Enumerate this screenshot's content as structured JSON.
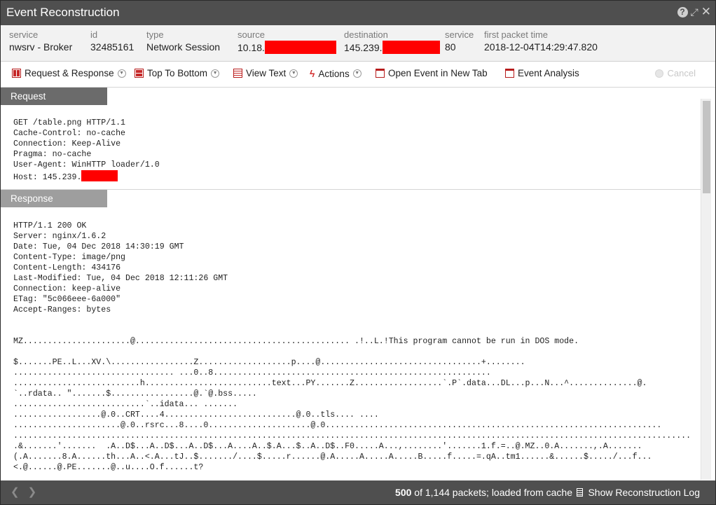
{
  "window": {
    "title": "Event Reconstruction",
    "help_icon": "help-icon",
    "expand_icon": "expand-icon",
    "close_icon": "close-icon"
  },
  "meta": {
    "service_label": "service",
    "service_value": "nwsrv - Broker",
    "id_label": "id",
    "id_value": "32485161",
    "type_label": "type",
    "type_value": "Network Session",
    "source_label": "source",
    "source_value": "10.18.",
    "destination_label": "destination",
    "destination_value": "145.239.",
    "service2_label": "service",
    "service2_value": "80",
    "first_packet_label": "first packet time",
    "first_packet_value": "2018-12-04T14:29:47.820",
    "redaction_color": "#ff0000"
  },
  "toolbar": {
    "request_response": "Request & Response",
    "top_to_bottom": "Top To Bottom",
    "view_text": "View Text",
    "actions": "Actions",
    "open_event": "Open Event in New Tab",
    "event_analysis": "Event Analysis",
    "cancel": "Cancel"
  },
  "request": {
    "heading": "Request",
    "lines": [
      "GET /table.png HTTP/1.1",
      "Cache-Control: no-cache",
      "Connection: Keep-Alive",
      "Pragma: no-cache",
      "User-Agent: WinHTTP loader/1.0",
      "Host: 145.239."
    ]
  },
  "response": {
    "heading": "Response",
    "lines": [
      "HTTP/1.1 200 OK",
      "Server: nginx/1.6.2",
      "Date: Tue, 04 Dec 2018 14:30:19 GMT",
      "Content-Type: image/png",
      "Content-Length: 434176",
      "Last-Modified: Tue, 04 Dec 2018 12:11:26 GMT",
      "Connection: keep-alive",
      "ETag: \"5c066eee-6a000\"",
      "Accept-Ranges: bytes"
    ],
    "payload_first": "MZ......................@............................................ .!..L.!This program cannot be run in DOS mode.",
    "payload_lines": [
      "$.......PE..L...XV.\\.................Z...................p....@.................................+........",
      "................................. ...0..8.........................................................",
      "..........................h..........................text...PY.......Z..................`.P`.data...DL...p...N...^..............@.",
      "`..rdata.. \".......$.................@.`@.bss.....",
      "...........................`..idata... .......",
      "..................@.0..CRT....4...........................@.0..tls.... ....",
      "......................@.0..rsrc...8....0.....................@.0.....................................................................",
      "...........................................................................................................................................",
      ".&.......'.......  .A..D$...A..D$...A..D$...A....A..$.A...$..A..D$..F0.....A...,........'.......1.f.=..@.MZ..0.A.......,.A.......",
      "(.A.......8.A......th...A..<.A...tJ..$......./....$.....r......@.A.....A.....A.....B.....f.....=.qA..tm1......&......$...../...f...",
      "<.@......@.PE.......@..u....O.f......t?"
    ]
  },
  "status": {
    "loaded_count": "500",
    "status_suffix": "of 1,144 packets; loaded from cache",
    "show_log": "Show Reconstruction Log",
    "prev_arrow": "❮",
    "next_arrow": "❯"
  }
}
